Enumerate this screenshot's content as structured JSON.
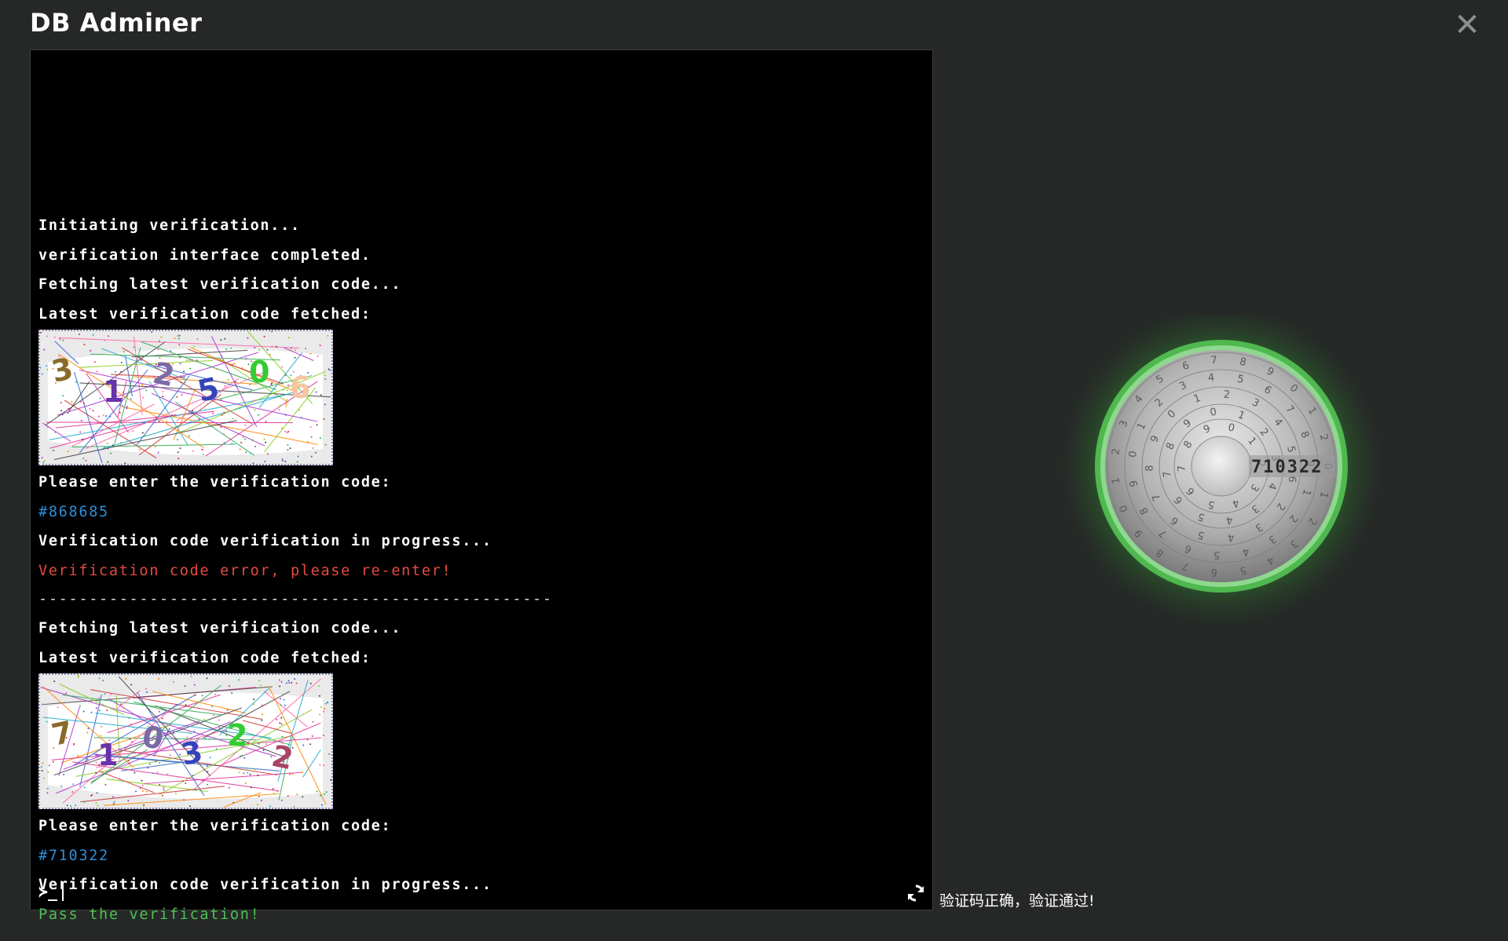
{
  "app": {
    "title": "DB Adminer",
    "close_label": "✕"
  },
  "terminal": {
    "lines": [
      {
        "text": "Initiating verification...",
        "type": "normal"
      },
      {
        "text": "verification interface completed.",
        "type": "normal"
      },
      {
        "text": "Fetching latest verification code...",
        "type": "normal"
      },
      {
        "text": "Latest verification code fetched:",
        "type": "normal"
      },
      {
        "type": "captcha",
        "captcha_text": "31250",
        "faded_char": "6"
      },
      {
        "text": "Please enter the verification code:",
        "type": "normal"
      },
      {
        "text": "#868685",
        "type": "code"
      },
      {
        "text": "Verification code verification in progress...",
        "type": "normal"
      },
      {
        "text": "Verification code error, please re-enter!",
        "type": "error"
      },
      {
        "text": "---------------------------------------------------",
        "type": "separator"
      },
      {
        "text": "Fetching latest verification code...",
        "type": "normal"
      },
      {
        "text": "Latest verification code fetched:",
        "type": "normal"
      },
      {
        "type": "captcha",
        "captcha_text": "710322",
        "faded_char": ""
      },
      {
        "text": "Please enter the verification code:",
        "type": "normal"
      },
      {
        "text": "#710322",
        "type": "code"
      },
      {
        "text": "Verification code verification in progress...",
        "type": "normal"
      },
      {
        "text": "Pass the verification!",
        "type": "success"
      }
    ],
    "prompt_symbol": "≻_",
    "refresh_icon": "refresh-icon"
  },
  "lock": {
    "display_code": "710322",
    "ring_color": "#5fc25f"
  },
  "status_message": "验证码正确，验证通过!",
  "colors": {
    "background": "#262727",
    "terminal_bg": "#000000",
    "code": "#2e8fd8",
    "error": "#e44b3f",
    "success": "#4dc255"
  }
}
